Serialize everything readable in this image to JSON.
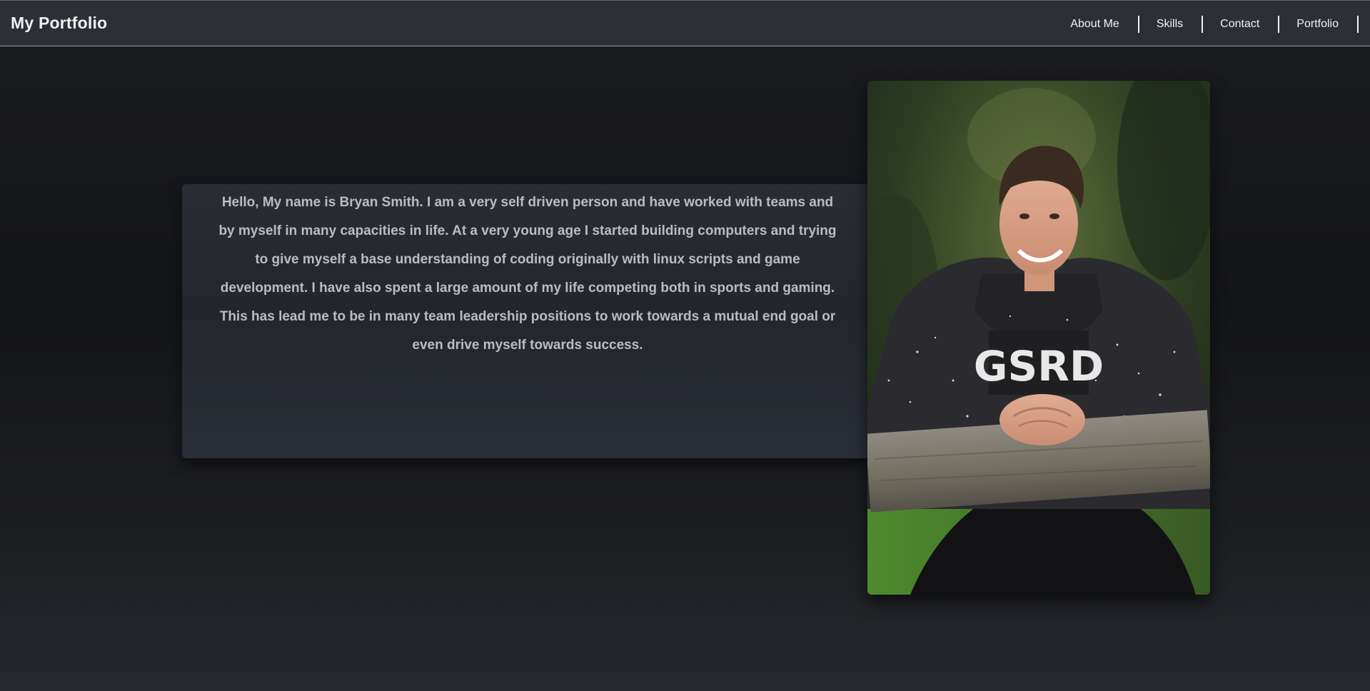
{
  "header": {
    "brand": "My Portfolio",
    "nav": [
      {
        "label": "About Me"
      },
      {
        "label": "Skills"
      },
      {
        "label": "Contact"
      },
      {
        "label": "Portfolio"
      }
    ]
  },
  "about": {
    "text": "Hello, My name is Bryan Smith. I am a very self driven person and have worked with teams and by myself in many capacities in life. At a very young age I started building computers and trying to give myself a base understanding of coding originally with linux scripts and game development. I have also spent a large amount of my life competing both in sports and gaming. This has lead me to be in many team leadership positions to work towards a mutual end goal or even drive myself towards success."
  },
  "photo": {
    "shirt_text": "GSRD"
  }
}
